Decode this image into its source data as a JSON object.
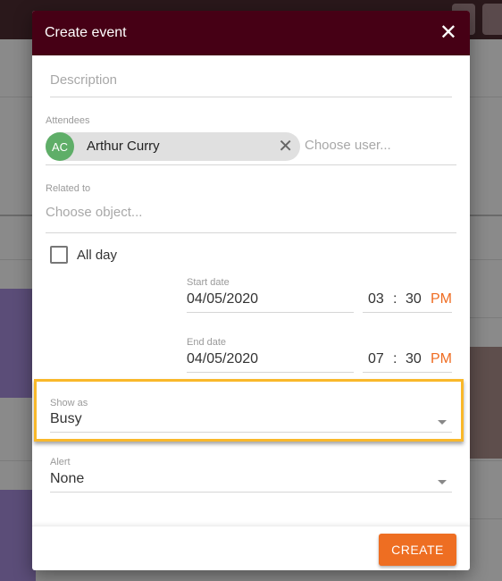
{
  "dialog": {
    "title": "Create event",
    "close_icon": "close-icon"
  },
  "description": {
    "placeholder": "Description"
  },
  "attendees": {
    "label": "Attendees",
    "chips": [
      {
        "initials": "AC",
        "name": "Arthur Curry",
        "avatar_color": "#5fae68"
      }
    ],
    "placeholder": "Choose user..."
  },
  "related": {
    "label": "Related to",
    "placeholder": "Choose object..."
  },
  "all_day": {
    "label": "All day",
    "checked": false
  },
  "start": {
    "label": "Start date",
    "date": "04/05/2020",
    "hour": "03",
    "sep": ":",
    "minute": "30",
    "ampm": "PM"
  },
  "end": {
    "label": "End date",
    "date": "04/05/2020",
    "hour": "07",
    "sep": ":",
    "minute": "30",
    "ampm": "PM"
  },
  "show_as": {
    "label": "Show as",
    "value": "Busy"
  },
  "alert": {
    "label": "Alert",
    "value": "None"
  },
  "footer": {
    "create_label": "CREATE"
  },
  "colors": {
    "header": "#460015",
    "accent": "#ee6e22",
    "highlight": "#f9b82a"
  }
}
